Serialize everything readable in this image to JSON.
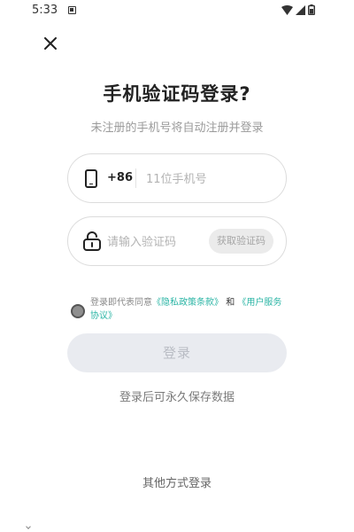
{
  "status_bar": {
    "time": "5:33"
  },
  "header": {
    "close_icon": "close-icon",
    "title": "手机验证码登录?",
    "subtitle": "未注册的手机号将自动注册并登录"
  },
  "phone": {
    "country_code": "+86",
    "placeholder": "11位手机号",
    "value": ""
  },
  "code": {
    "placeholder": "请输入验证码",
    "value": "",
    "get_code_label": "获取验证码"
  },
  "agreement": {
    "prefix": "登录即代表同意",
    "privacy_link": "《隐私政策条款》",
    "and": "和",
    "service_link": "《用户服务协议》",
    "checked": false
  },
  "actions": {
    "login_label": "登录",
    "save_note": "登录后可永久保存数据",
    "other_login": "其他方式登录"
  },
  "colors": {
    "link": "#2bb5a5",
    "button_bg": "#e9ebf0",
    "button_text": "#b9bcc4"
  }
}
